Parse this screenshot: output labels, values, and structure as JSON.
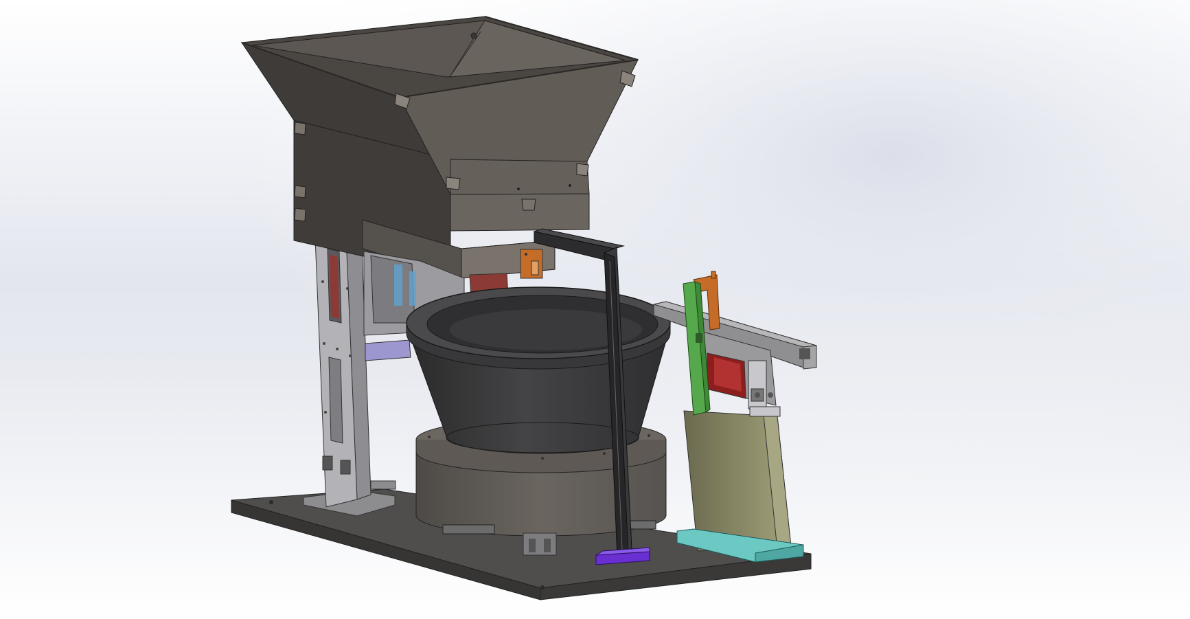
{
  "viewport": {
    "background_top": "#ffffff",
    "background_mid": "#dfe2ea",
    "background_bottom": "#ffffff"
  },
  "model": {
    "components": [
      {
        "name": "hopper",
        "color": "#5e5a55"
      },
      {
        "name": "vibratory-bowl",
        "color": "#3c3c3d"
      },
      {
        "name": "drive-base",
        "color": "#5b5753"
      },
      {
        "name": "base-plate",
        "color": "#4f4e4d"
      },
      {
        "name": "support-column",
        "color": "#a9a9ad"
      },
      {
        "name": "sensor-bracket",
        "color": "#2c2c2e"
      },
      {
        "name": "linear-feeder-rail",
        "color": "#a5a5a7"
      },
      {
        "name": "linear-feeder-body",
        "color": "#9a9a72"
      },
      {
        "name": "green-guard",
        "color": "#55a84b"
      },
      {
        "name": "orange-bracket",
        "color": "#c46c28"
      },
      {
        "name": "teal-mount",
        "color": "#6cc8c3"
      },
      {
        "name": "purple-foot",
        "color": "#6a2fd0"
      },
      {
        "name": "red-slot",
        "color": "#8c3a35"
      }
    ]
  }
}
